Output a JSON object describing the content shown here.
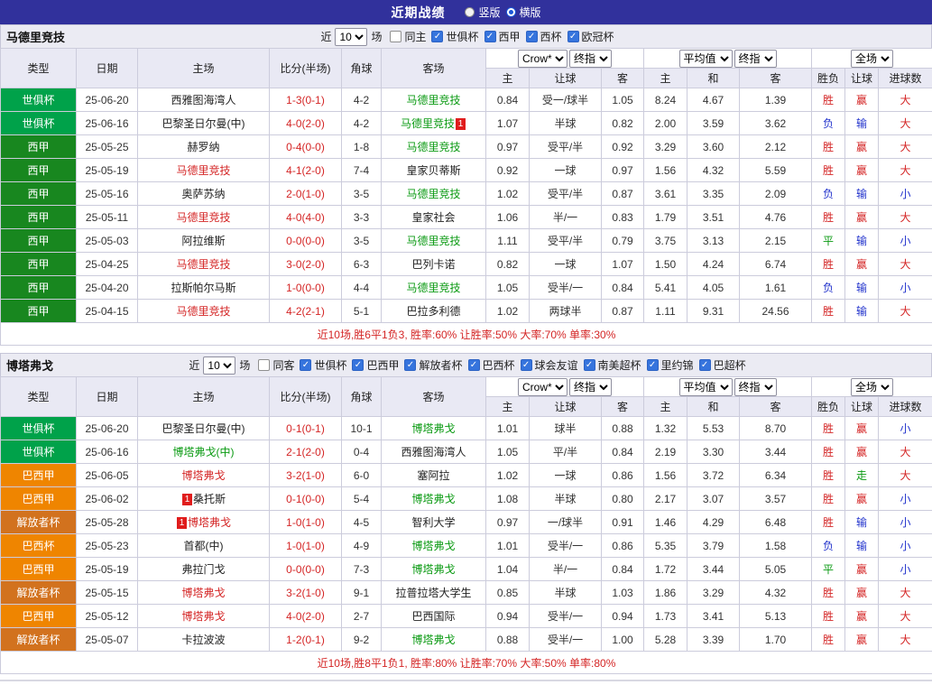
{
  "colors": {
    "topbar_bg": "#31319c",
    "section_bar_bg": "#ebebf3",
    "table_header_bg": "#e9e9f4",
    "win_red": "#d42525",
    "loss_blue": "#2233cc",
    "draw_green": "#0a9a12",
    "type_colors": {
      "世俱杯": "#00a24a",
      "西甲": "#18871f",
      "巴西甲": "#ef8500",
      "解放者杯": "#d2721e",
      "巴西杯": "#ef8500"
    }
  },
  "top_bar": {
    "title": "近期战绩",
    "radios": [
      {
        "label": "竖版",
        "checked": false
      },
      {
        "label": "横版",
        "checked": true
      }
    ]
  },
  "table_headers": {
    "type": "类型",
    "date": "日期",
    "home": "主场",
    "score": "比分(半场)",
    "corner": "角球",
    "away": "客场",
    "asia_home": "主",
    "asia_handicap": "让球",
    "asia_away": "客",
    "euro_home": "主",
    "euro_draw": "和",
    "euro_away": "客",
    "result": "胜负",
    "cover": "让球",
    "goals": "进球数"
  },
  "controls": {
    "near_label": "近",
    "near_count": "10",
    "games_label": "场",
    "asia_source": "Crow*",
    "asia_index": "终指",
    "euro_source": "平均值",
    "euro_index": "终指",
    "scope": "全场"
  },
  "sections": [
    {
      "team": "马德里竞技",
      "same_filter": {
        "label": "同主",
        "checked": false
      },
      "league_filters": [
        {
          "label": "世俱杯",
          "checked": true
        },
        {
          "label": "西甲",
          "checked": true
        },
        {
          "label": "西杯",
          "checked": true
        },
        {
          "label": "欧冠杯",
          "checked": true
        }
      ],
      "rows": [
        {
          "type": "世俱杯",
          "date": "25-06-20",
          "home": "西雅图海湾人",
          "home_color": "black",
          "home_badge": "",
          "score": "1-3(0-1)",
          "corner": "4-2",
          "away": "马德里竞技",
          "away_color": "green",
          "away_badge": "",
          "asia": [
            "0.84",
            "受一/球半",
            "1.05"
          ],
          "euro": [
            "8.24",
            "4.67",
            "1.39"
          ],
          "result": "胜",
          "result_color": "red",
          "cover": "赢",
          "cover_color": "red",
          "goals": "大",
          "goals_color": "red"
        },
        {
          "type": "世俱杯",
          "date": "25-06-16",
          "home": "巴黎圣日尔曼(中)",
          "home_color": "black",
          "home_badge": "",
          "score": "4-0(2-0)",
          "corner": "4-2",
          "away": "马德里竞技",
          "away_color": "green",
          "away_badge": "1",
          "asia": [
            "1.07",
            "半球",
            "0.82"
          ],
          "euro": [
            "2.00",
            "3.59",
            "3.62"
          ],
          "result": "负",
          "result_color": "blue",
          "cover": "输",
          "cover_color": "blue",
          "goals": "大",
          "goals_color": "red"
        },
        {
          "type": "西甲",
          "date": "25-05-25",
          "home": "赫罗纳",
          "home_color": "black",
          "home_badge": "",
          "score": "0-4(0-0)",
          "corner": "1-8",
          "away": "马德里竞技",
          "away_color": "green",
          "away_badge": "",
          "asia": [
            "0.97",
            "受平/半",
            "0.92"
          ],
          "euro": [
            "3.29",
            "3.60",
            "2.12"
          ],
          "result": "胜",
          "result_color": "red",
          "cover": "赢",
          "cover_color": "red",
          "goals": "大",
          "goals_color": "red"
        },
        {
          "type": "西甲",
          "date": "25-05-19",
          "home": "马德里竞技",
          "home_color": "red",
          "home_badge": "",
          "score": "4-1(2-0)",
          "corner": "7-4",
          "away": "皇家贝蒂斯",
          "away_color": "black",
          "away_badge": "",
          "asia": [
            "0.92",
            "一球",
            "0.97"
          ],
          "euro": [
            "1.56",
            "4.32",
            "5.59"
          ],
          "result": "胜",
          "result_color": "red",
          "cover": "赢",
          "cover_color": "red",
          "goals": "大",
          "goals_color": "red"
        },
        {
          "type": "西甲",
          "date": "25-05-16",
          "home": "奥萨苏纳",
          "home_color": "black",
          "home_badge": "",
          "score": "2-0(1-0)",
          "corner": "3-5",
          "away": "马德里竞技",
          "away_color": "green",
          "away_badge": "",
          "asia": [
            "1.02",
            "受平/半",
            "0.87"
          ],
          "euro": [
            "3.61",
            "3.35",
            "2.09"
          ],
          "result": "负",
          "result_color": "blue",
          "cover": "输",
          "cover_color": "blue",
          "goals": "小",
          "goals_color": "blue"
        },
        {
          "type": "西甲",
          "date": "25-05-11",
          "home": "马德里竞技",
          "home_color": "red",
          "home_badge": "",
          "score": "4-0(4-0)",
          "corner": "3-3",
          "away": "皇家社会",
          "away_color": "black",
          "away_badge": "",
          "asia": [
            "1.06",
            "半/一",
            "0.83"
          ],
          "euro": [
            "1.79",
            "3.51",
            "4.76"
          ],
          "result": "胜",
          "result_color": "red",
          "cover": "赢",
          "cover_color": "red",
          "goals": "大",
          "goals_color": "red"
        },
        {
          "type": "西甲",
          "date": "25-05-03",
          "home": "阿拉维斯",
          "home_color": "black",
          "home_badge": "",
          "score": "0-0(0-0)",
          "corner": "3-5",
          "away": "马德里竞技",
          "away_color": "green",
          "away_badge": "",
          "asia": [
            "1.11",
            "受平/半",
            "0.79"
          ],
          "euro": [
            "3.75",
            "3.13",
            "2.15"
          ],
          "result": "平",
          "result_color": "green",
          "cover": "输",
          "cover_color": "blue",
          "goals": "小",
          "goals_color": "blue"
        },
        {
          "type": "西甲",
          "date": "25-04-25",
          "home": "马德里竞技",
          "home_color": "red",
          "home_badge": "",
          "score": "3-0(2-0)",
          "corner": "6-3",
          "away": "巴列卡诺",
          "away_color": "black",
          "away_badge": "",
          "asia": [
            "0.82",
            "一球",
            "1.07"
          ],
          "euro": [
            "1.50",
            "4.24",
            "6.74"
          ],
          "result": "胜",
          "result_color": "red",
          "cover": "赢",
          "cover_color": "red",
          "goals": "大",
          "goals_color": "red"
        },
        {
          "type": "西甲",
          "date": "25-04-20",
          "home": "拉斯帕尔马斯",
          "home_color": "black",
          "home_badge": "",
          "score": "1-0(0-0)",
          "corner": "4-4",
          "away": "马德里竞技",
          "away_color": "green",
          "away_badge": "",
          "asia": [
            "1.05",
            "受半/一",
            "0.84"
          ],
          "euro": [
            "5.41",
            "4.05",
            "1.61"
          ],
          "result": "负",
          "result_color": "blue",
          "cover": "输",
          "cover_color": "blue",
          "goals": "小",
          "goals_color": "blue"
        },
        {
          "type": "西甲",
          "date": "25-04-15",
          "home": "马德里竞技",
          "home_color": "red",
          "home_badge": "",
          "score": "4-2(2-1)",
          "corner": "5-1",
          "away": "巴拉多利德",
          "away_color": "black",
          "away_badge": "",
          "asia": [
            "1.02",
            "两球半",
            "0.87"
          ],
          "euro": [
            "1.11",
            "9.31",
            "24.56"
          ],
          "result": "胜",
          "result_color": "red",
          "cover": "输",
          "cover_color": "blue",
          "goals": "大",
          "goals_color": "red"
        }
      ],
      "summary": "近10场,胜6平1负3, 胜率:60% 让胜率:50% 大率:70% 单率:30%"
    },
    {
      "team": "博塔弗戈",
      "same_filter": {
        "label": "同客",
        "checked": false
      },
      "league_filters": [
        {
          "label": "世俱杯",
          "checked": true
        },
        {
          "label": "巴西甲",
          "checked": true
        },
        {
          "label": "解放者杯",
          "checked": true
        },
        {
          "label": "巴西杯",
          "checked": true
        },
        {
          "label": "球会友谊",
          "checked": true
        },
        {
          "label": "南美超杯",
          "checked": true
        },
        {
          "label": "里约锦",
          "checked": true
        },
        {
          "label": "巴超杯",
          "checked": true
        }
      ],
      "rows": [
        {
          "type": "世俱杯",
          "date": "25-06-20",
          "home": "巴黎圣日尔曼(中)",
          "home_color": "black",
          "home_badge": "",
          "score": "0-1(0-1)",
          "corner": "10-1",
          "away": "博塔弗戈",
          "away_color": "green",
          "away_badge": "",
          "asia": [
            "1.01",
            "球半",
            "0.88"
          ],
          "euro": [
            "1.32",
            "5.53",
            "8.70"
          ],
          "result": "胜",
          "result_color": "red",
          "cover": "赢",
          "cover_color": "red",
          "goals": "小",
          "goals_color": "blue"
        },
        {
          "type": "世俱杯",
          "date": "25-06-16",
          "home": "博塔弗戈(中)",
          "home_color": "green",
          "home_badge": "",
          "score": "2-1(2-0)",
          "corner": "0-4",
          "away": "西雅图海湾人",
          "away_color": "black",
          "away_badge": "",
          "asia": [
            "1.05",
            "平/半",
            "0.84"
          ],
          "euro": [
            "2.19",
            "3.30",
            "3.44"
          ],
          "result": "胜",
          "result_color": "red",
          "cover": "赢",
          "cover_color": "red",
          "goals": "大",
          "goals_color": "red"
        },
        {
          "type": "巴西甲",
          "date": "25-06-05",
          "home": "博塔弗戈",
          "home_color": "red",
          "home_badge": "",
          "score": "3-2(1-0)",
          "corner": "6-0",
          "away": "塞阿拉",
          "away_color": "black",
          "away_badge": "",
          "asia": [
            "1.02",
            "一球",
            "0.86"
          ],
          "euro": [
            "1.56",
            "3.72",
            "6.34"
          ],
          "result": "胜",
          "result_color": "red",
          "cover": "走",
          "cover_color": "green",
          "goals": "大",
          "goals_color": "red"
        },
        {
          "type": "巴西甲",
          "date": "25-06-02",
          "home": "桑托斯",
          "home_color": "black",
          "home_badge": "1",
          "score": "0-1(0-0)",
          "corner": "5-4",
          "away": "博塔弗戈",
          "away_color": "green",
          "away_badge": "",
          "asia": [
            "1.08",
            "半球",
            "0.80"
          ],
          "euro": [
            "2.17",
            "3.07",
            "3.57"
          ],
          "result": "胜",
          "result_color": "red",
          "cover": "赢",
          "cover_color": "red",
          "goals": "小",
          "goals_color": "blue"
        },
        {
          "type": "解放者杯",
          "date": "25-05-28",
          "home": "博塔弗戈",
          "home_color": "red",
          "home_badge": "1",
          "score": "1-0(1-0)",
          "corner": "4-5",
          "away": "智利大学",
          "away_color": "black",
          "away_badge": "",
          "asia": [
            "0.97",
            "一/球半",
            "0.91"
          ],
          "euro": [
            "1.46",
            "4.29",
            "6.48"
          ],
          "result": "胜",
          "result_color": "red",
          "cover": "输",
          "cover_color": "blue",
          "goals": "小",
          "goals_color": "blue"
        },
        {
          "type": "巴西杯",
          "date": "25-05-23",
          "home": "首都(中)",
          "home_color": "black",
          "home_badge": "",
          "score": "1-0(1-0)",
          "corner": "4-9",
          "away": "博塔弗戈",
          "away_color": "green",
          "away_badge": "",
          "asia": [
            "1.01",
            "受半/一",
            "0.86"
          ],
          "euro": [
            "5.35",
            "3.79",
            "1.58"
          ],
          "result": "负",
          "result_color": "blue",
          "cover": "输",
          "cover_color": "blue",
          "goals": "小",
          "goals_color": "blue"
        },
        {
          "type": "巴西甲",
          "date": "25-05-19",
          "home": "弗拉门戈",
          "home_color": "black",
          "home_badge": "",
          "score": "0-0(0-0)",
          "corner": "7-3",
          "away": "博塔弗戈",
          "away_color": "green",
          "away_badge": "",
          "asia": [
            "1.04",
            "半/一",
            "0.84"
          ],
          "euro": [
            "1.72",
            "3.44",
            "5.05"
          ],
          "result": "平",
          "result_color": "green",
          "cover": "赢",
          "cover_color": "red",
          "goals": "小",
          "goals_color": "blue"
        },
        {
          "type": "解放者杯",
          "date": "25-05-15",
          "home": "博塔弗戈",
          "home_color": "red",
          "home_badge": "",
          "score": "3-2(1-0)",
          "corner": "9-1",
          "away": "拉普拉塔大学生",
          "away_color": "black",
          "away_badge": "",
          "asia": [
            "0.85",
            "半球",
            "1.03"
          ],
          "euro": [
            "1.86",
            "3.29",
            "4.32"
          ],
          "result": "胜",
          "result_color": "red",
          "cover": "赢",
          "cover_color": "red",
          "goals": "大",
          "goals_color": "red"
        },
        {
          "type": "巴西甲",
          "date": "25-05-12",
          "home": "博塔弗戈",
          "home_color": "red",
          "home_badge": "",
          "score": "4-0(2-0)",
          "corner": "2-7",
          "away": "巴西国际",
          "away_color": "black",
          "away_badge": "",
          "asia": [
            "0.94",
            "受半/一",
            "0.94"
          ],
          "euro": [
            "1.73",
            "3.41",
            "5.13"
          ],
          "result": "胜",
          "result_color": "red",
          "cover": "赢",
          "cover_color": "red",
          "goals": "大",
          "goals_color": "red"
        },
        {
          "type": "解放者杯",
          "date": "25-05-07",
          "home": "卡拉波波",
          "home_color": "black",
          "home_badge": "",
          "score": "1-2(0-1)",
          "corner": "9-2",
          "away": "博塔弗戈",
          "away_color": "green",
          "away_badge": "",
          "asia": [
            "0.88",
            "受半/一",
            "1.00"
          ],
          "euro": [
            "5.28",
            "3.39",
            "1.70"
          ],
          "result": "胜",
          "result_color": "red",
          "cover": "赢",
          "cover_color": "red",
          "goals": "大",
          "goals_color": "red"
        }
      ],
      "summary": "近10场,胜8平1负1, 胜率:80% 让胜率:70% 大率:50% 单率:80%"
    }
  ]
}
